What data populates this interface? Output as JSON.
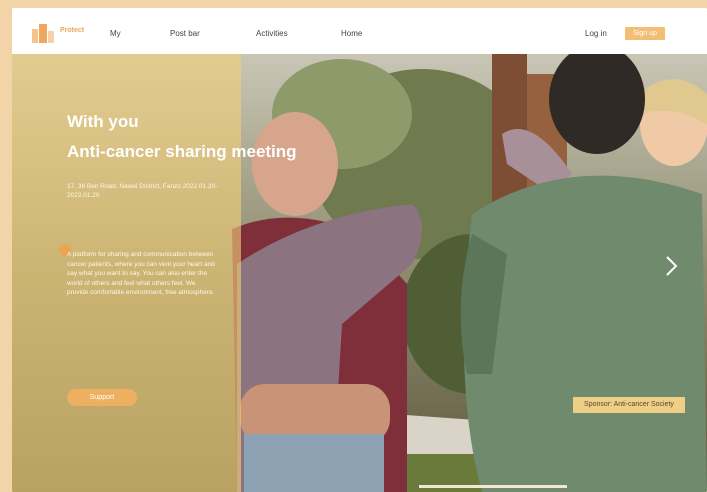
{
  "brand": {
    "logo_text": "Protect"
  },
  "nav": {
    "items": [
      "My",
      "Post bar",
      "Activities",
      "Home"
    ],
    "login": "Log in",
    "signup": "Sign up"
  },
  "hero": {
    "title_line1": "With you",
    "title_line2": "Anti-cancer sharing meeting",
    "address": "17, 36 Ben Road, Nawei District, Fanzo 2022.01.20-2022.01.20",
    "description": "A platform for sharing and communication between cancer patients, where you can vent your heart and say what you want to say. You can also enter the world of others and feel what others feel. We provide comfortable environment, free atmosphere.",
    "support_button": "Support",
    "sponsor": "Sponsor: Anti-cancer Society",
    "next_icon": "chevron-right-icon"
  },
  "colors": {
    "accent": "#f2bd74",
    "overlay": "#f2ce78",
    "sponsor_bg": "#efcf86"
  }
}
